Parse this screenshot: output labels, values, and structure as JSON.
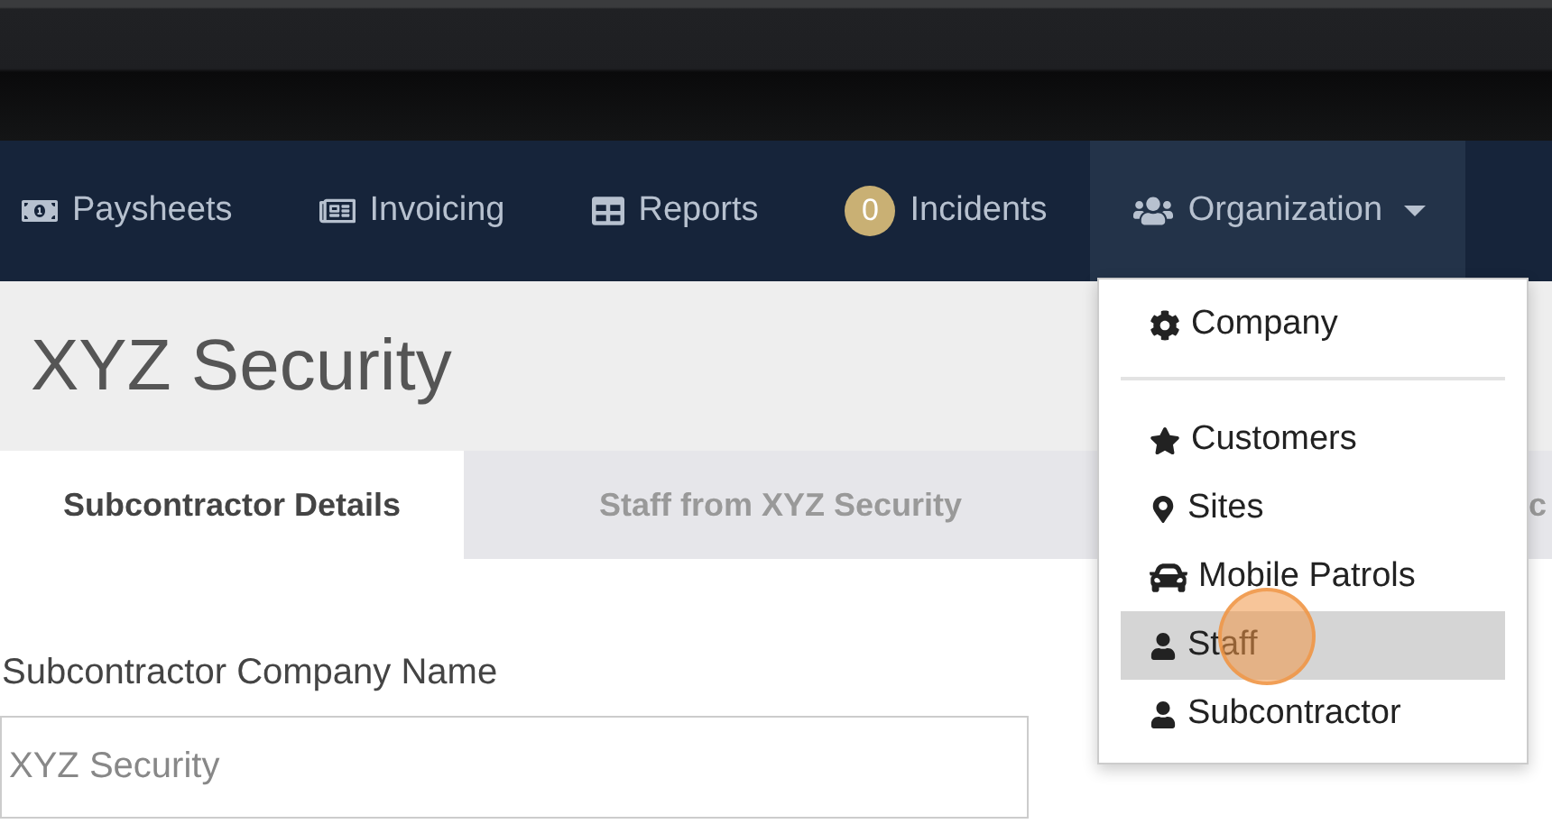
{
  "nav": [
    {
      "kind": "paysheets",
      "label": "Paysheets",
      "selected": false
    },
    {
      "kind": "invoicing",
      "label": "Invoicing",
      "selected": false
    },
    {
      "kind": "reports",
      "label": "Reports",
      "selected": false
    },
    {
      "kind": "incidents",
      "label": "Incidents",
      "badge": "0",
      "selected": false
    },
    {
      "kind": "organization",
      "label": "Organization",
      "selected": true
    }
  ],
  "page_title": "XYZ Security",
  "tabs": [
    {
      "label": "Subcontractor Details",
      "selected": true
    },
    {
      "label": "Staff from XYZ Security",
      "selected": false
    },
    {
      "label": "c",
      "selected": false
    }
  ],
  "form": {
    "label": "Subcontractor Company Name",
    "placeholder": "XYZ Security"
  },
  "dropdown": [
    {
      "kind": "company",
      "label": "Company",
      "selected": false
    },
    {
      "kind": "divider"
    },
    {
      "kind": "customers",
      "label": "Customers",
      "selected": false
    },
    {
      "kind": "sites",
      "label": "Sites",
      "selected": false
    },
    {
      "kind": "patrols",
      "label": "Mobile Patrols",
      "selected": false
    },
    {
      "kind": "staff",
      "label": "Staff",
      "selected": true
    },
    {
      "kind": "subcontractor",
      "label": "Subcontractor",
      "selected": false
    }
  ]
}
